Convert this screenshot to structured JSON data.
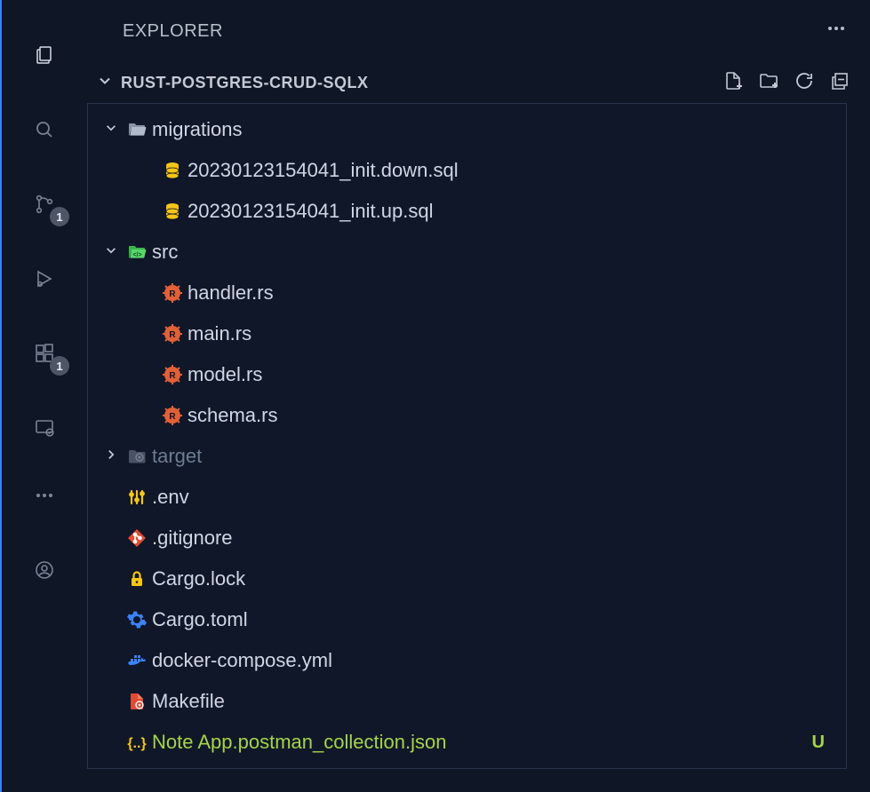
{
  "header": {
    "title": "EXPLORER",
    "project": "RUST-POSTGRES-CRUD-SQLX"
  },
  "badges": {
    "scm": "1",
    "extensions": "1"
  },
  "tree": [
    {
      "type": "folder",
      "depth": 0,
      "expanded": true,
      "name": "migrations",
      "icon": "folder-open",
      "muted": false
    },
    {
      "type": "file",
      "depth": 1,
      "name": "20230123154041_init.down.sql",
      "icon": "db"
    },
    {
      "type": "file",
      "depth": 1,
      "name": "20230123154041_init.up.sql",
      "icon": "db"
    },
    {
      "type": "folder",
      "depth": 0,
      "expanded": true,
      "name": "src",
      "icon": "folder-src",
      "muted": false
    },
    {
      "type": "file",
      "depth": 1,
      "name": "handler.rs",
      "icon": "rust"
    },
    {
      "type": "file",
      "depth": 1,
      "name": "main.rs",
      "icon": "rust"
    },
    {
      "type": "file",
      "depth": 1,
      "name": "model.rs",
      "icon": "rust"
    },
    {
      "type": "file",
      "depth": 1,
      "name": "schema.rs",
      "icon": "rust"
    },
    {
      "type": "folder",
      "depth": 0,
      "expanded": false,
      "name": "target",
      "icon": "folder-target",
      "muted": true
    },
    {
      "type": "file",
      "depth": 0,
      "name": ".env",
      "icon": "env"
    },
    {
      "type": "file",
      "depth": 0,
      "name": ".gitignore",
      "icon": "git"
    },
    {
      "type": "file",
      "depth": 0,
      "name": "Cargo.lock",
      "icon": "lock"
    },
    {
      "type": "file",
      "depth": 0,
      "name": "Cargo.toml",
      "icon": "gear"
    },
    {
      "type": "file",
      "depth": 0,
      "name": "docker-compose.yml",
      "icon": "docker"
    },
    {
      "type": "file",
      "depth": 0,
      "name": "Makefile",
      "icon": "makefile"
    },
    {
      "type": "file",
      "depth": 0,
      "name": "Note App.postman_collection.json",
      "icon": "json",
      "gitStatus": "U",
      "new": true
    }
  ]
}
